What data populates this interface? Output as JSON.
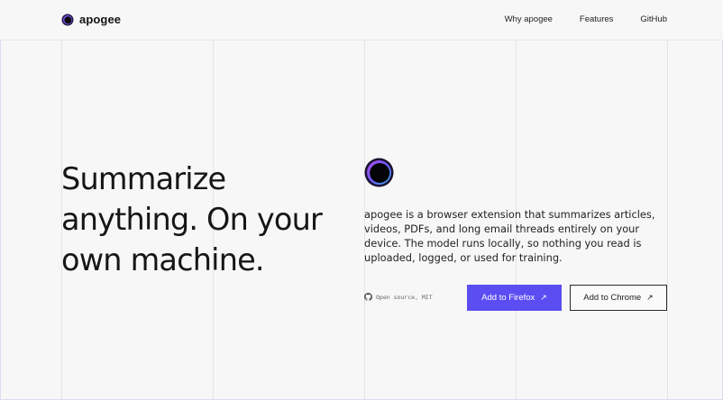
{
  "brand": {
    "name": "apogee",
    "icon": "apogee-logo-icon"
  },
  "nav": {
    "items": [
      {
        "label": "Why apogee"
      },
      {
        "label": "Features"
      },
      {
        "label": "GitHub"
      }
    ]
  },
  "hero": {
    "headline": "Summarize anything. On your own machine.",
    "description": "apogee is a browser extension that summarizes articles, videos, PDFs, and long email threads entirely on your device. The model runs locally, so nothing you read is uploaded, logged, or used for training.",
    "open_source_label": "Open source, MIT",
    "firefox_button": {
      "label": "Add to Firefox",
      "arrow": "↗"
    },
    "chrome_button": {
      "label": "Add to Chrome",
      "arrow": "↗"
    }
  },
  "colors": {
    "accent": "#5b4df2",
    "logo_ring": "#7a5cf0",
    "background": "#f7f7f7"
  }
}
